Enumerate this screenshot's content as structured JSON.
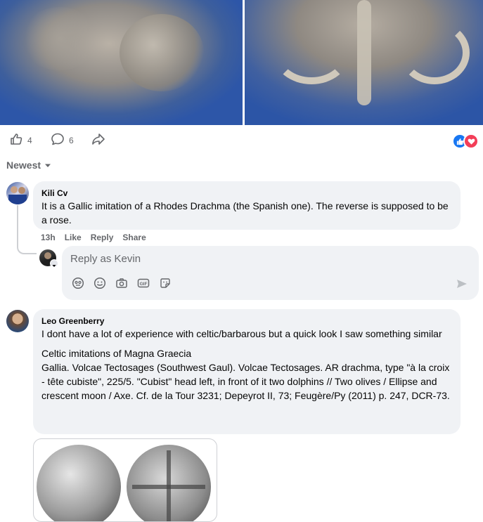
{
  "post": {
    "like_count": "4",
    "comment_count": "6",
    "sort_label": "Newest"
  },
  "comments": [
    {
      "author": "Kili Cv",
      "text": "It is a Gallic imitation of a Rhodes Drachma (the Spanish one). The reverse is supposed to be a rose.",
      "time": "13h",
      "like_label": "Like",
      "reply_label": "Reply",
      "share_label": "Share"
    },
    {
      "author": "Leo Greenberry",
      "text_line1": "I dont have a lot of experience with celtic/barbarous but a quick look I saw something similar",
      "text_heading": "Celtic imitations of Magna Graecia",
      "text_body": "Gallia. Volcae Tectosages (Southwest Gaul). Volcae Tectosages. AR drachma, type \"à la croix - tête cubiste\", 225/5. \"Cubist\" head left, in front of it two dolphins // Two olives / Ellipse and crescent moon / Axe. Cf. de la Tour 3231; Depeyrot II, 73; Feugère/Py (2011) p. 247, DCR-73."
    }
  ],
  "reply_box": {
    "placeholder": "Reply as Kevin"
  },
  "icons": {
    "like": "thumbs-up-icon",
    "comment": "comment-bubble-icon",
    "share": "share-arrow-icon",
    "reactions": [
      "like-reaction-icon",
      "love-reaction-icon"
    ],
    "sort": "caret-down-icon",
    "reply_tools": [
      "avatar-sticker-icon",
      "emoji-icon",
      "camera-icon",
      "gif-icon",
      "sticker-icon"
    ],
    "send": "send-icon"
  },
  "colors": {
    "accent": "#1877f2",
    "love": "#f33e58",
    "bubble": "#f0f2f5",
    "muted_text": "#65676b"
  }
}
